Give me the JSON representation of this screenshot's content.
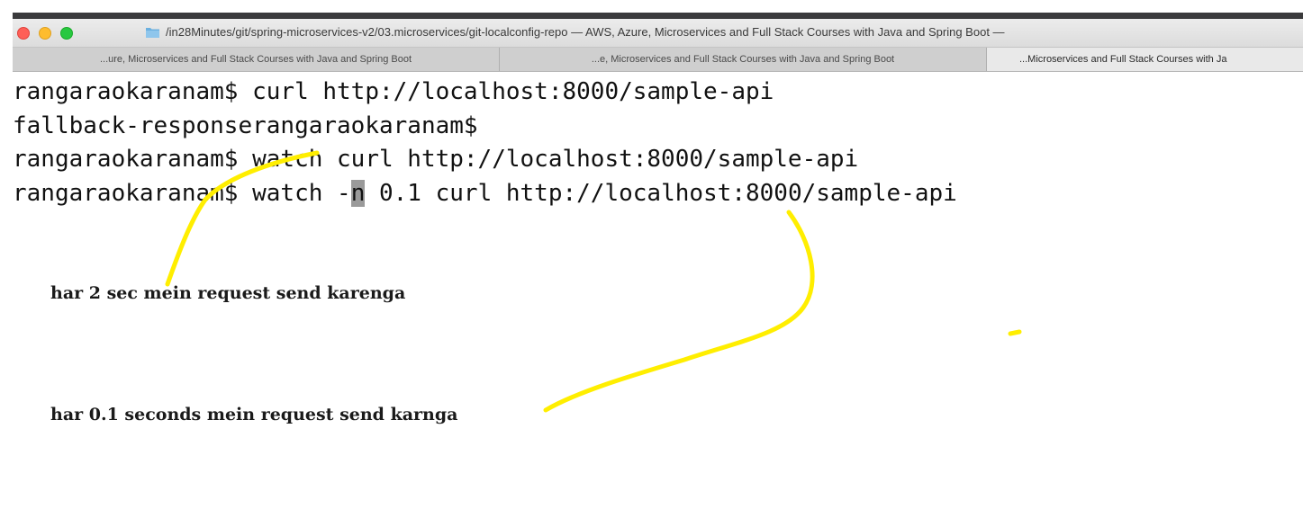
{
  "window": {
    "title": "/in28Minutes/git/spring-microservices-v2/03.microservices/git-localconfig-repo — AWS, Azure, Microservices and Full Stack Courses with Java and Spring Boot —"
  },
  "tabs": [
    {
      "label": "...ure, Microservices and Full Stack Courses with Java and Spring Boot",
      "active": false
    },
    {
      "label": "...e, Microservices and Full Stack Courses with Java and Spring Boot",
      "active": false
    },
    {
      "label": "...Microservices and Full Stack Courses with Ja",
      "active": true
    }
  ],
  "terminal": {
    "line1": "rangaraokaranam$ curl http://localhost:8000/sample-api",
    "line2": "fallback-responserangaraokaranam$",
    "line3": "rangaraokaranam$ watch curl http://localhost:8000/sample-api",
    "line4_before_cursor": "rangaraokaranam$ watch -",
    "line4_cursor_char": "n",
    "line4_after_cursor": " 0.1 curl http://localhost:8000/sample-api"
  },
  "annotations": {
    "note1": "har 2 sec mein request send karenga",
    "note2": "har 0.1 seconds mein request send karnga"
  },
  "colors": {
    "highlighter": "#ffee00",
    "close": "#fe5f57",
    "minimize": "#febc2e",
    "maximize": "#28c840"
  }
}
